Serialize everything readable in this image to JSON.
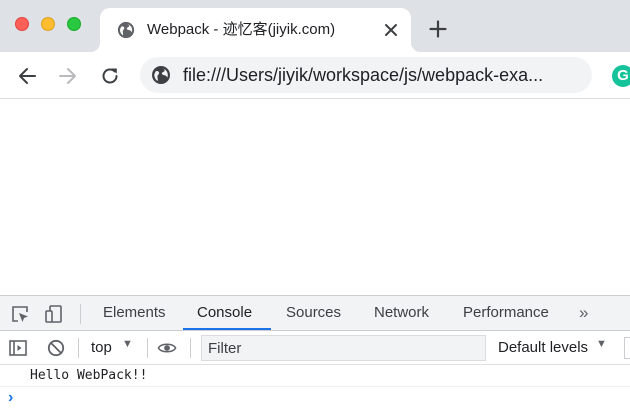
{
  "tab": {
    "title": "Webpack - 迹忆客(jiyik.com)"
  },
  "omnibox": {
    "url": "file:///Users/jiyik/workspace/js/webpack-exa..."
  },
  "extension": {
    "letter": "G"
  },
  "devtools": {
    "tabs": [
      {
        "label": "Elements",
        "active": false
      },
      {
        "label": "Console",
        "active": true
      },
      {
        "label": "Sources",
        "active": false
      },
      {
        "label": "Network",
        "active": false
      },
      {
        "label": "Performance",
        "active": false
      }
    ],
    "more_label": "»",
    "context_label": "top",
    "filter_placeholder": "Filter",
    "levels_label": "Default levels",
    "messages": [
      "Hello WebPack!!"
    ],
    "prompt_symbol": "›"
  },
  "colors": {
    "tabstrip": "#dee1e6",
    "accent": "#1a73e8",
    "close_red": "#fe5f57",
    "minimize_yellow": "#febc2e",
    "zoom_green": "#28c840",
    "grammarly_green": "#15c39a"
  },
  "icons": {
    "tab_favicon": "globe-icon",
    "tab_close": "close-icon",
    "new_tab": "plus-icon",
    "back": "arrow-left-icon",
    "forward": "arrow-right-icon",
    "reload": "reload-icon",
    "site_info": "globe-icon",
    "inspect": "inspect-element-icon",
    "device": "device-toolbar-icon",
    "sidebar": "console-sidebar-icon",
    "clear": "clear-console-icon",
    "live_expression": "eye-icon"
  }
}
